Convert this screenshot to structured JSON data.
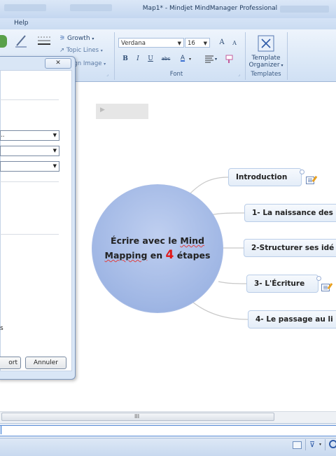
{
  "window": {
    "title": "Map1* - Mindjet MindManager Professional"
  },
  "tabs": {
    "help": "Help"
  },
  "ribbon": {
    "growth": "Growth",
    "topic_lines": "Topic Lines",
    "align_image": "ign Image",
    "font_name": "Verdana",
    "font_size": "16",
    "font_group": "Font",
    "bold": "B",
    "italic": "I",
    "underline": "U",
    "strike": "abc",
    "grow_font": "A",
    "shrink_font": "A",
    "font_color": "A",
    "template_organizer_line1": "Template",
    "template_organizer_line2": "Organizer",
    "templates_group": "Templates"
  },
  "dialog": {
    "close_symbol": "✕",
    "combo1_value": "..",
    "report_button": "ort",
    "cancel_button": "Annuler",
    "side_letter": "s"
  },
  "map": {
    "placeholder_arrow": "▶",
    "central_line1_pre": "Écrire avec le ",
    "central_line1_mind": "Mind",
    "central_line2_mapping": "Mapping",
    "central_line2_en": " en ",
    "central_number": "4",
    "central_line2_post": " étapes",
    "topics": [
      "Introduction",
      "1- La naissance des",
      "2-Structurer ses idé",
      "3- L'Écriture",
      "4- Le passage au li"
    ]
  },
  "scrollbar": {
    "grip": "III"
  }
}
